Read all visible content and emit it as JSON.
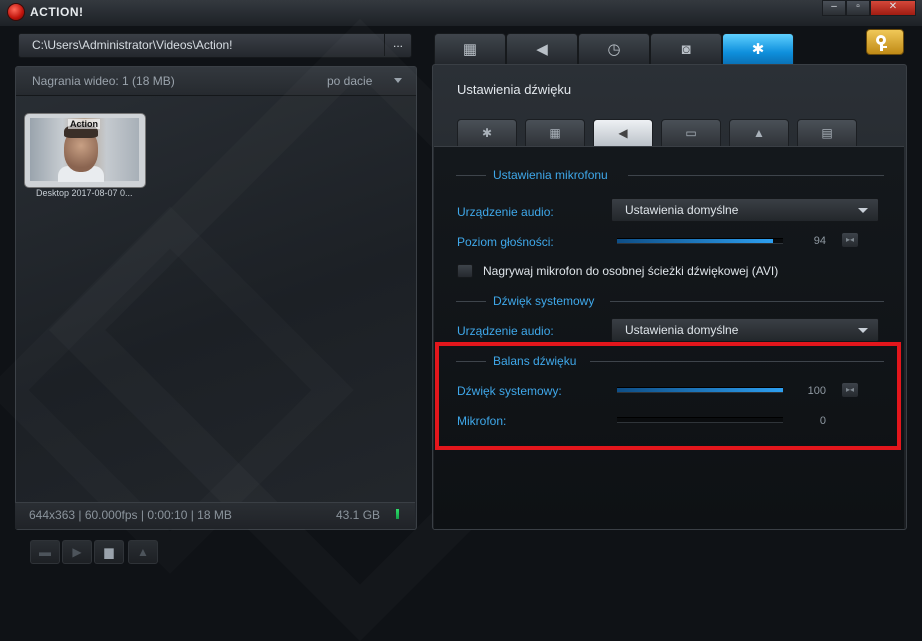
{
  "app": {
    "title": "ACTION!"
  },
  "window_controls": {
    "minimize": "–",
    "restore": "▫",
    "close": "✕"
  },
  "left": {
    "path": "C:\\Users\\Administrator\\Videos\\Action!",
    "browse_label": "...",
    "header_label": "Nagrania wideo: 1 (18 MB)",
    "sort_label": "po dacie",
    "items": [
      {
        "caption": "Desktop 2017-08-07 0...",
        "watermark": "Action"
      }
    ],
    "footer_info": "644x363 | 60.000fps | 0:00:10 | 18 MB",
    "disk_free": "43.1 GB"
  },
  "main_tabs": [
    {
      "icon": "film-icon",
      "glyph": "▦"
    },
    {
      "icon": "speaker-icon",
      "glyph": "◀"
    },
    {
      "icon": "stopwatch-icon",
      "glyph": "◷"
    },
    {
      "icon": "camera-icon",
      "glyph": "◙"
    },
    {
      "icon": "gear-icon",
      "glyph": "✱",
      "active": true
    }
  ],
  "settings": {
    "title": "Ustawienia dźwięku",
    "subtabs": [
      {
        "icon": "gear-icon",
        "glyph": "✱"
      },
      {
        "icon": "film-icon",
        "glyph": "▦"
      },
      {
        "icon": "speaker-icon",
        "glyph": "◀",
        "active": true
      },
      {
        "icon": "monitor-icon",
        "glyph": "▭"
      },
      {
        "icon": "upload-icon",
        "glyph": "▲"
      },
      {
        "icon": "keyboard-icon",
        "glyph": "▤"
      }
    ],
    "mic": {
      "group_title": "Ustawienia mikrofonu",
      "device_label": "Urządzenie audio:",
      "device_value": "Ustawienia domyślne",
      "volume_label": "Poziom głośności:",
      "volume_value": "94",
      "separate_track_label": "Nagrywaj mikrofon do osobnej ścieżki dźwiękowej (AVI)"
    },
    "system": {
      "group_title": "Dźwięk systemowy",
      "device_label": "Urządzenie audio:",
      "device_value": "Ustawienia domyślne"
    },
    "balance": {
      "group_title": "Balans dźwięku",
      "system_label": "Dźwięk systemowy:",
      "system_value": "100",
      "mic_label": "Mikrofon:",
      "mic_value": "0"
    }
  }
}
